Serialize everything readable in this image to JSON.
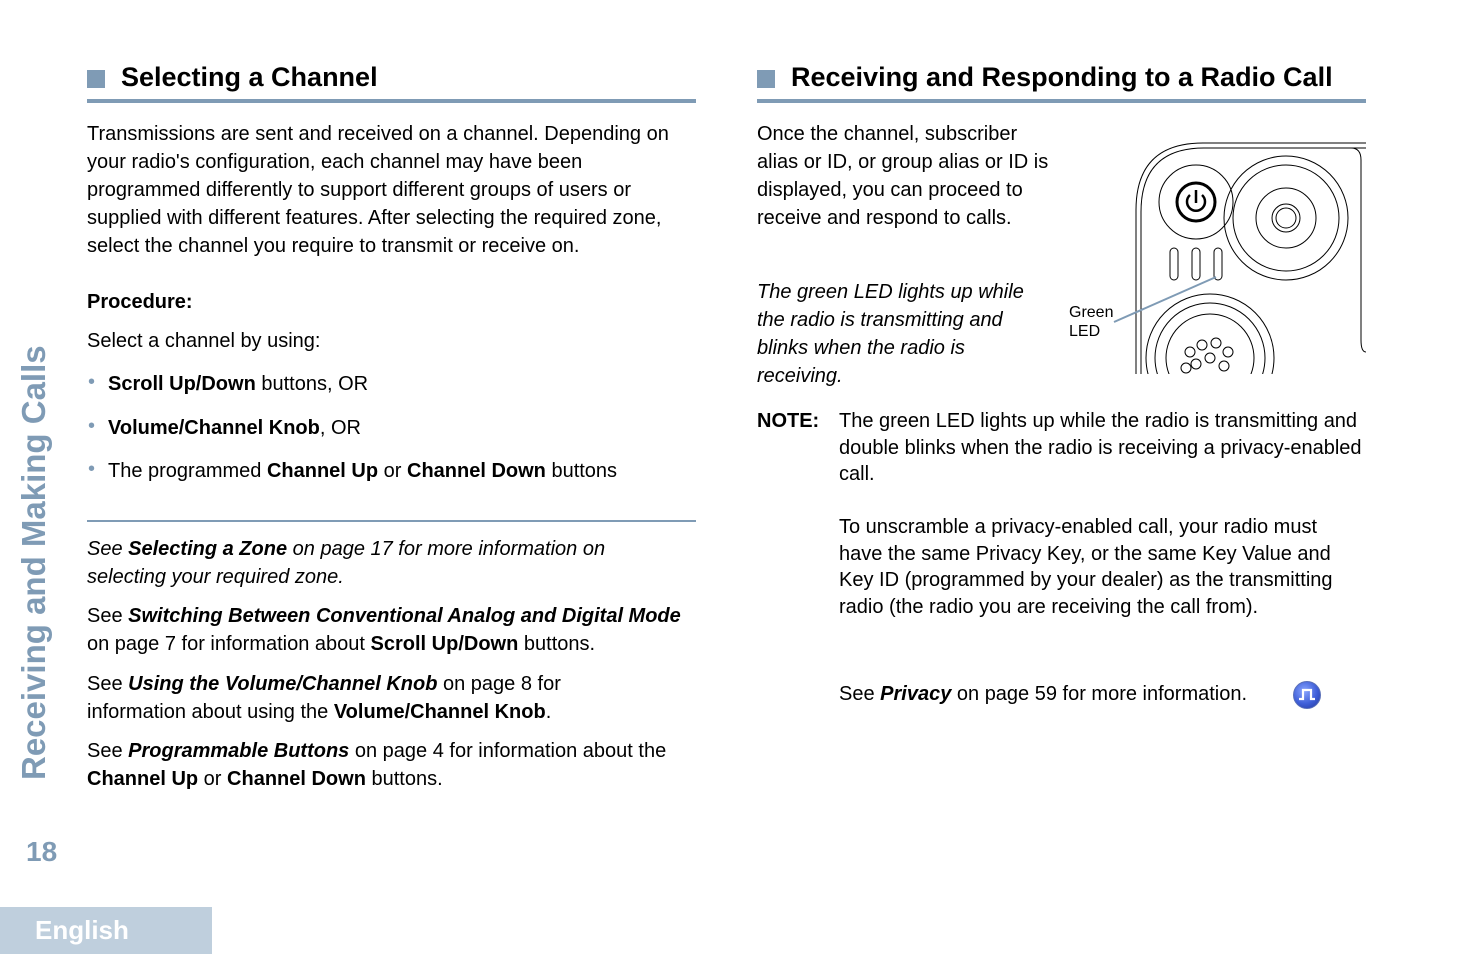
{
  "sidebar": {
    "chapter_title": "Receiving and Making Calls",
    "page_number": "18",
    "language_tab": "English"
  },
  "left_section": {
    "heading": "Selecting a Channel",
    "intro": "Transmissions are sent and received on a channel. Depending on your radio's configuration, each channel may have been programmed differently to support different groups of users or supplied with different features. After selecting the required zone, select the channel you require to transmit or receive on.",
    "procedure_label": "Procedure:",
    "select_intro": "Select a channel by using:",
    "bullets": [
      {
        "bold": "Scroll Up/Down",
        "rest": " buttons, OR"
      },
      {
        "bold": "Volume/Channel Knob",
        "rest": ", OR"
      },
      {
        "pre": "The programmed ",
        "bold1": "Channel Up",
        "mid": " or ",
        "bold2": "Channel Down",
        "rest": " buttons"
      }
    ],
    "refs": [
      {
        "pre": "See ",
        "link": "Selecting a Zone",
        "post": " on page 17 for more information on selecting your required zone."
      },
      {
        "pre": "See ",
        "link": "Switching Between Conventional Analog and Digital Mode",
        "mid": " on page 7 for information about ",
        "bold": "Scroll Up/Down",
        "post": " buttons."
      },
      {
        "pre": "See ",
        "link": "Using the Volume/Channel Knob",
        "mid": " on page 8 for information about using the ",
        "bold": "Volume/Channel Knob",
        "post": "."
      },
      {
        "pre": "See ",
        "link": "Programmable Buttons",
        "mid": " on page 4 for information about the ",
        "bold1": "Channel Up",
        "mid2": " or ",
        "bold2": "Channel Down",
        "post": " buttons."
      }
    ]
  },
  "right_section": {
    "heading": "Receiving and Responding to a Radio Call",
    "intro": "Once the channel, subscriber alias or ID, or group alias or ID is displayed, you can proceed to receive and respond to calls.",
    "led_caption": "The green LED lights up while the radio is transmitting and blinks when the radio is receiving.",
    "figure_label_line1": "Green",
    "figure_label_line2": "LED",
    "note_label": "NOTE:",
    "note_para1": "The green LED lights up while the radio is transmitting and double blinks when the radio is receiving a privacy-enabled call.",
    "note_para2": "To unscramble a privacy-enabled call, your radio must have the same Privacy Key, or the same Key Value and Key ID (programmed by your dealer) as the transmitting radio (the radio you are receiving the call from).",
    "see_pre": "See ",
    "see_link": "Privacy",
    "see_post": " on page 59 for more information.",
    "feature_icon": "privacy-feature-icon"
  }
}
